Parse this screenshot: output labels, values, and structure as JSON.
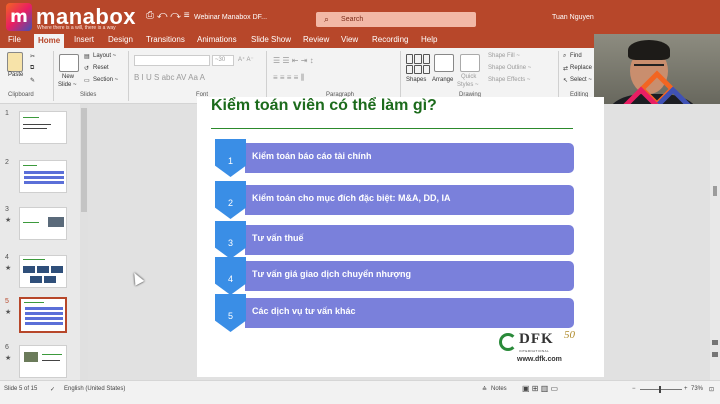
{
  "titlebar": {
    "logo_letter": "m",
    "logo_text": "manabox",
    "logo_slogan": "Where there is a will, there is a way",
    "qat_icons": "⎙ ↶ ↷ ≡",
    "doc_title": "Webinar Manabox DF...",
    "search_placeholder": "Search",
    "username": "Tuan Nguyen"
  },
  "tabs": [
    "File",
    "Home",
    "Insert",
    "Design",
    "Transitions",
    "Animations",
    "Slide Show",
    "Review",
    "View",
    "Recording",
    "Help"
  ],
  "ribbon": {
    "clipboard": {
      "paste": "Paste",
      "label": "Clipboard"
    },
    "slides": {
      "new_slide": "New",
      "new_slide2": "Slide ~",
      "layout": "Layout ~",
      "reset": "Reset",
      "section": "Section ~",
      "label": "Slides"
    },
    "font": {
      "label": "Font",
      "size": "~30"
    },
    "paragraph": {
      "label": "Paragraph"
    },
    "drawing": {
      "shapes": "Shapes",
      "arrange": "Arrange",
      "quick": "Quick",
      "styles": "Styles ~",
      "shape_fill": "Shape Fill ~",
      "shape_outline": "Shape Outline ~",
      "shape_effects": "Shape Effects ~",
      "label": "Drawing"
    },
    "editing": {
      "find": "Find",
      "replace": "Replace ~",
      "select": "Select ~",
      "label": "Editing"
    }
  },
  "thumbnails": [
    {
      "num": "1"
    },
    {
      "num": "2"
    },
    {
      "num": "3",
      "star": "★"
    },
    {
      "num": "4",
      "star": "★"
    },
    {
      "num": "5",
      "star": "★",
      "active": true
    },
    {
      "num": "6",
      "star": "★"
    }
  ],
  "slide": {
    "title": "Kiểm toán viên có thể làm gì?",
    "items": [
      {
        "num": "1",
        "text": "Kiểm toán báo cáo tài chính"
      },
      {
        "num": "2",
        "text": "Kiểm toán cho mục đích đặc biệt: M&A, DD, IA"
      },
      {
        "num": "3",
        "text": "Tư vấn thuế"
      },
      {
        "num": "4",
        "text": "Tư vấn giá giao dịch chuyển nhượng"
      },
      {
        "num": "5",
        "text": "Các dịch vụ tư vấn khác"
      }
    ],
    "logo_text": "DFK",
    "logo_anniv": "50",
    "logo_sub": "INTERNATIONAL",
    "url": "www.dfk.com"
  },
  "status": {
    "slide_pos": "Slide 5 of 15",
    "language": "English (United States)",
    "notes": "Notes",
    "zoom": "73%"
  },
  "colors": {
    "accent": "#b7472a",
    "bar": "#7a80db",
    "chevron": "#3a8ee6",
    "title_green": "#1c6b1c"
  }
}
